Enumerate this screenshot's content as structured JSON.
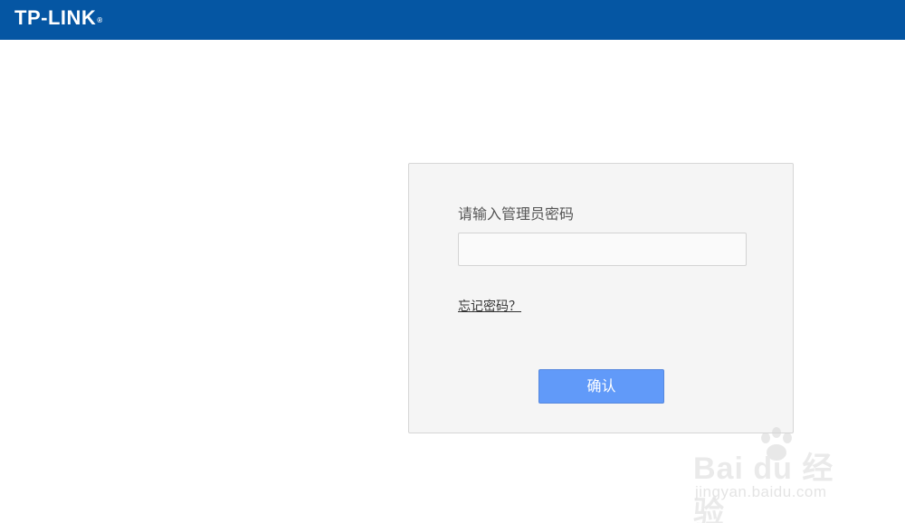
{
  "header": {
    "logo_text": "TP-LINK",
    "logo_mark": "®",
    "background_color": "#0556a3"
  },
  "login": {
    "prompt": "请输入管理员密码",
    "password_value": "",
    "forgot_link": "忘记密码？",
    "confirm_button": "确认",
    "button_color": "#619af9"
  },
  "watermark": {
    "brand": "Bai du 经验",
    "url": "jingyan.baidu.com"
  }
}
